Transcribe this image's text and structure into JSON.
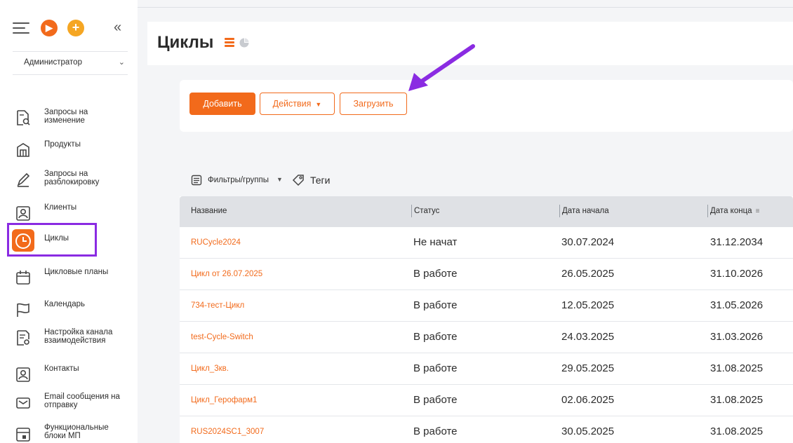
{
  "sidebar": {
    "role": "Администратор",
    "items": [
      {
        "label": "Запросы на изменение",
        "icon": "document-search-icon"
      },
      {
        "label": "Продукты",
        "icon": "box-icon"
      },
      {
        "label": "Запросы на разблокировку",
        "icon": "pencil-icon"
      },
      {
        "label": "Клиенты",
        "icon": "person-card-icon"
      },
      {
        "label": "Циклы",
        "icon": "clock-icon",
        "active": true
      },
      {
        "label": "Цикловые планы",
        "icon": "calendar-icon"
      },
      {
        "label": "Календарь",
        "icon": "flag-icon"
      },
      {
        "label": "Настройка канала взаимодействия",
        "icon": "document-gear-icon"
      },
      {
        "label": "Контакты",
        "icon": "person-card-icon"
      },
      {
        "label": "Email сообщения на отправку",
        "icon": "mail-icon"
      },
      {
        "label": "Функциональные блоки МП",
        "icon": "layout-icon"
      }
    ]
  },
  "header": {
    "title": "Циклы"
  },
  "actions": {
    "add_label": "Добавить",
    "actions_label": "Действия",
    "upload_label": "Загрузить"
  },
  "filters": {
    "groups_label": "Фильтры/группы",
    "tags_label": "Теги"
  },
  "table": {
    "columns": [
      "Название",
      "Статус",
      "Дата начала",
      "Дата конца"
    ],
    "rows": [
      {
        "name": "RUCycle2024",
        "status": "Не начат",
        "start": "30.07.2024",
        "end": "31.12.2034"
      },
      {
        "name": "Цикл от 26.07.2025",
        "status": "В работе",
        "start": "26.05.2025",
        "end": "31.10.2026"
      },
      {
        "name": "734-тест-Цикл",
        "status": "В работе",
        "start": "12.05.2025",
        "end": "31.05.2026"
      },
      {
        "name": "test-Cycle-Switch",
        "status": "В работе",
        "start": "24.03.2025",
        "end": "31.03.2026"
      },
      {
        "name": "Цикл_3кв.",
        "status": "В работе",
        "start": "29.05.2025",
        "end": "31.08.2025"
      },
      {
        "name": "Цикл_Герофарм1",
        "status": "В работе",
        "start": "02.06.2025",
        "end": "31.08.2025"
      },
      {
        "name": "RUS2024SC1_3007",
        "status": "В работе",
        "start": "30.05.2025",
        "end": "31.08.2025"
      }
    ]
  },
  "colors": {
    "accent": "#f26a1b",
    "highlight": "#8a2be2",
    "header_bg": "#dfe1e5"
  }
}
